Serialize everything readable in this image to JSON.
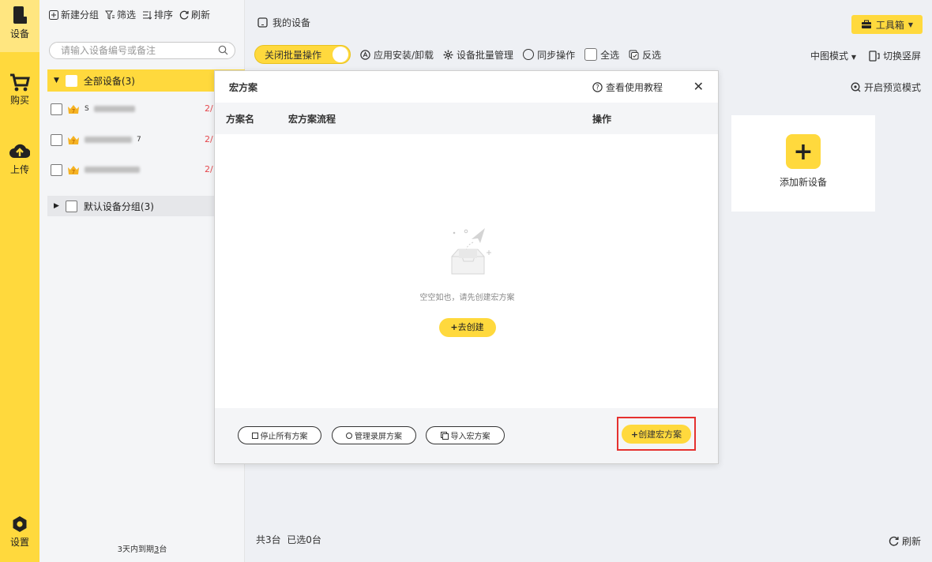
{
  "rail": {
    "items": [
      {
        "label": "设备",
        "icon": "device-icon"
      },
      {
        "label": "购买",
        "icon": "cart-icon"
      },
      {
        "label": "上传",
        "icon": "upload-icon"
      },
      {
        "label": "设置",
        "icon": "gear-icon"
      }
    ]
  },
  "panel": {
    "toolbar": {
      "new_group": "新建分组",
      "filter": "筛选",
      "sort": "排序",
      "refresh": "刷新"
    },
    "search_placeholder": "请输入设备编号或备注",
    "all_devices": "全部设备(3)",
    "devices": [
      {
        "name_suffix": "S",
        "badge": "7",
        "date": "2/"
      },
      {
        "name_suffix": "7",
        "badge": "7",
        "date": "2/"
      },
      {
        "name_suffix": "",
        "badge": "7",
        "date": "2/"
      }
    ],
    "default_group": "默认设备分组(3)",
    "expire_prefix": "3天内到期",
    "expire_count": "3",
    "expire_suffix": "台"
  },
  "main": {
    "title": "我的设备",
    "toolbox": "工具箱",
    "batch_toggle": "关闭批量操作",
    "toolbar": {
      "install": "应用安装/卸载",
      "batch_manage": "设备批量管理",
      "sync": "同步操作",
      "select_all": "全选",
      "invert": "反选"
    },
    "view_mode": "中图模式",
    "switch_screen": "切换竖屏",
    "preview_mode": "开启预览模式",
    "add_device": "添加新设备",
    "footer_total": "共3台",
    "footer_selected": "已选0台",
    "refresh": "刷新"
  },
  "modal": {
    "title": "宏方案",
    "help": "查看使用教程",
    "columns": {
      "name": "方案名",
      "flow": "宏方案流程",
      "action": "操作"
    },
    "empty_text": "空空如也，请先创建宏方案",
    "go_create": "去创建",
    "footer": {
      "stop_all": "停止所有方案",
      "manage_record": "管理录屏方案",
      "import": "导入宏方案",
      "create": "创建宏方案"
    }
  },
  "colors": {
    "accent": "#ffd93d",
    "danger": "#e5312f",
    "date_red": "#e5484d"
  }
}
